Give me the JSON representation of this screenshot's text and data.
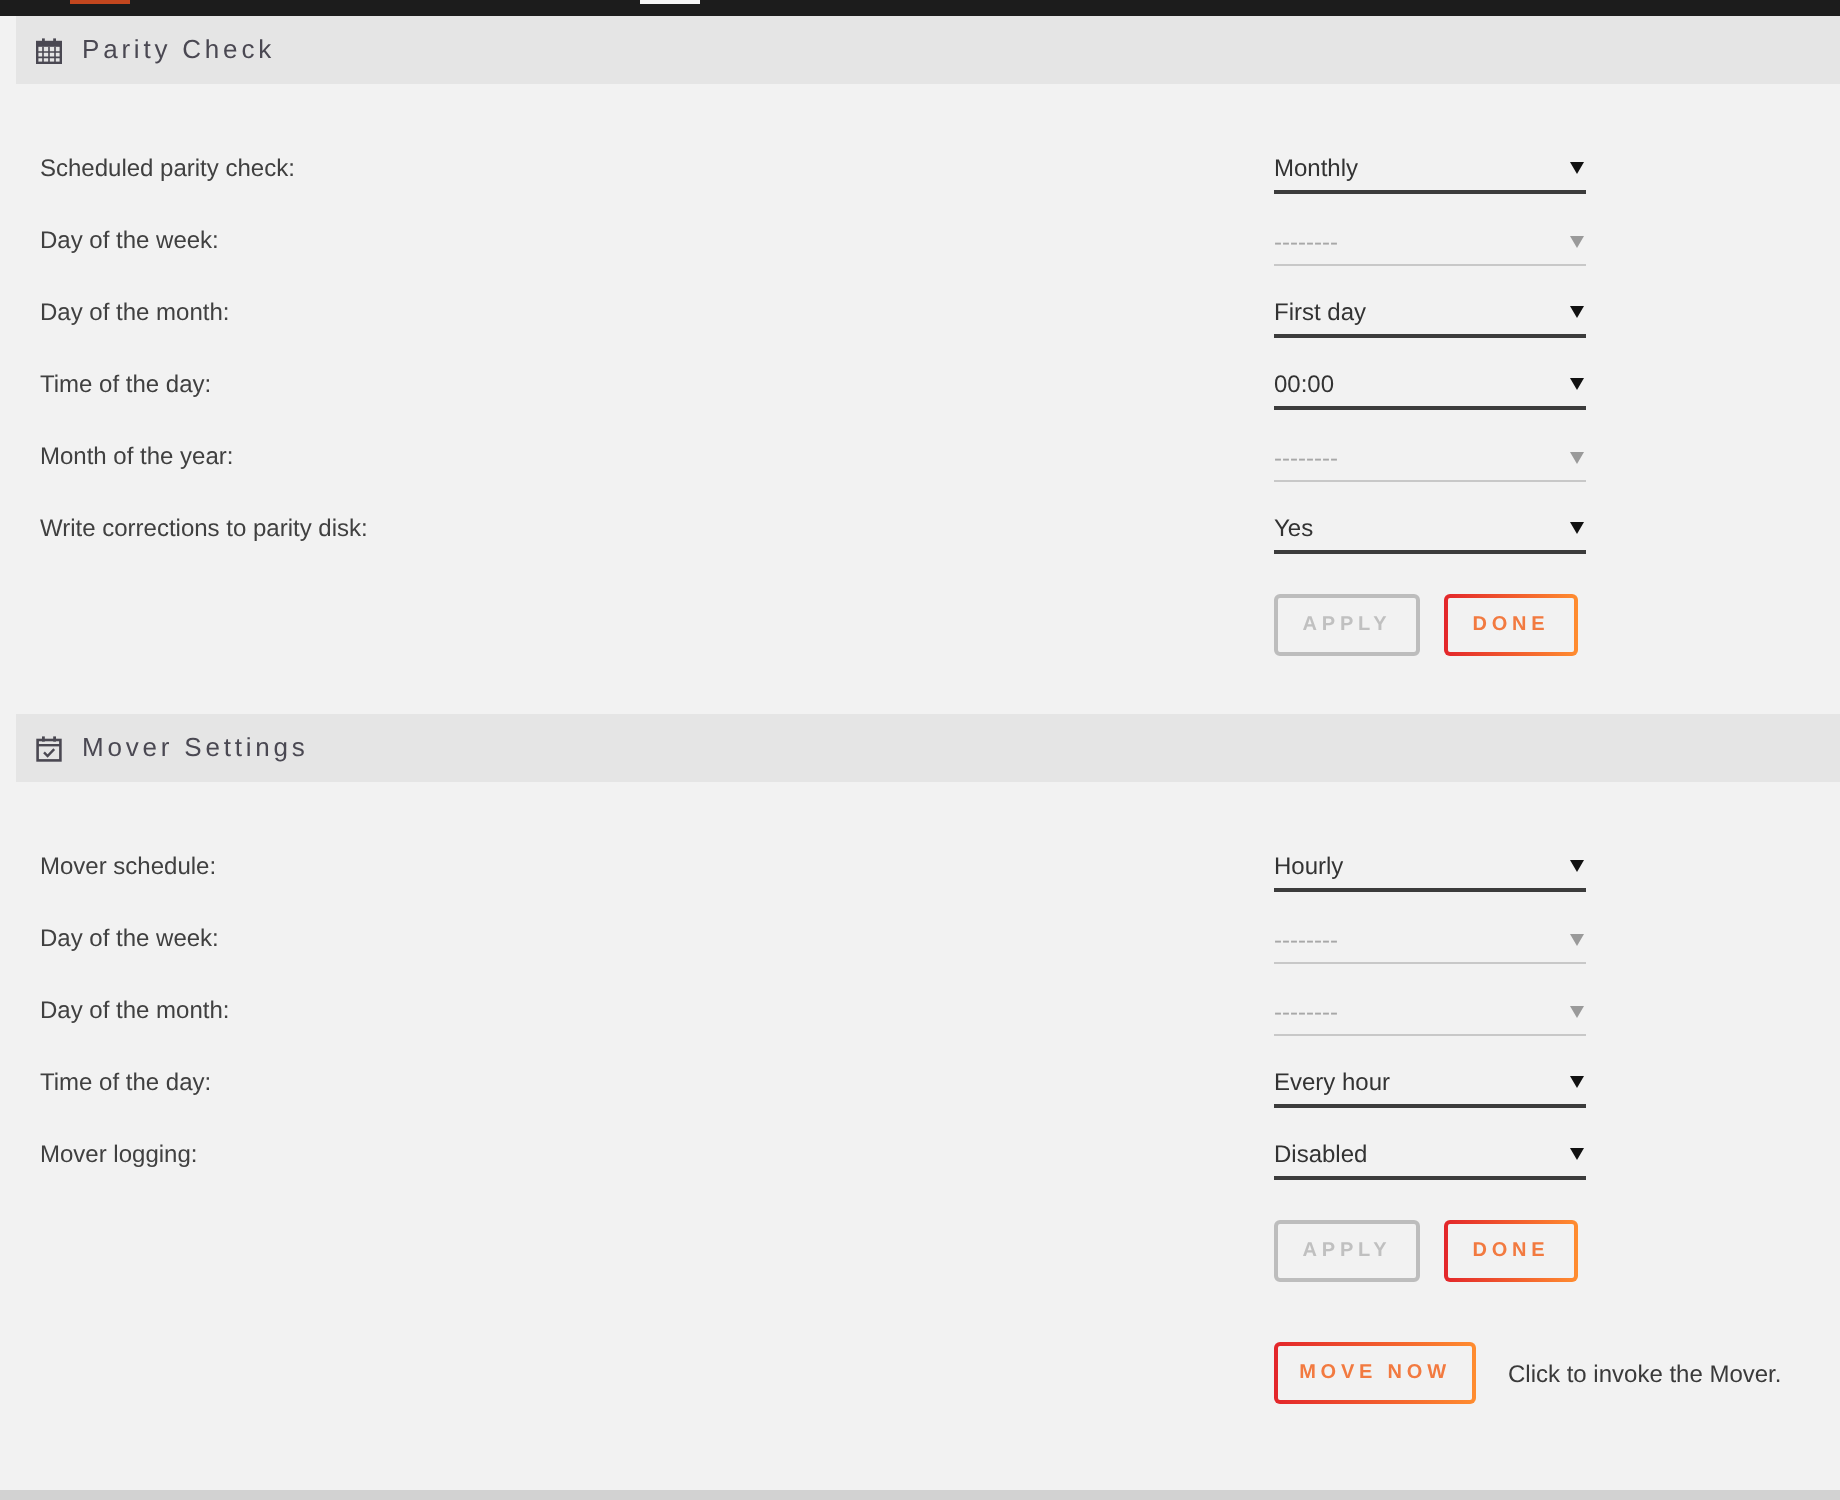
{
  "sections": [
    {
      "title": "Parity Check",
      "fields": [
        {
          "label": "Scheduled parity check:",
          "value": "Monthly",
          "disabled": false
        },
        {
          "label": "Day of the week:",
          "value": "--------",
          "disabled": true
        },
        {
          "label": "Day of the month:",
          "value": "First day",
          "disabled": false
        },
        {
          "label": "Time of the day:",
          "value": "00:00",
          "disabled": false
        },
        {
          "label": "Month of the year:",
          "value": "--------",
          "disabled": true
        },
        {
          "label": "Write corrections to parity disk:",
          "value": "Yes",
          "disabled": false
        }
      ],
      "buttons": [
        {
          "label": "APPLY",
          "disabled": true
        },
        {
          "label": "DONE",
          "disabled": false
        }
      ]
    },
    {
      "title": "Mover Settings",
      "fields": [
        {
          "label": "Mover schedule:",
          "value": "Hourly",
          "disabled": false
        },
        {
          "label": "Day of the week:",
          "value": "--------",
          "disabled": true
        },
        {
          "label": "Day of the month:",
          "value": "--------",
          "disabled": true
        },
        {
          "label": "Time of the day:",
          "value": "Every hour",
          "disabled": false
        },
        {
          "label": "Mover logging:",
          "value": "Disabled",
          "disabled": false
        }
      ],
      "buttons": [
        {
          "label": "APPLY",
          "disabled": true
        },
        {
          "label": "DONE",
          "disabled": false
        }
      ],
      "action": {
        "button": "MOVE NOW",
        "note": "Click to invoke the Mover."
      }
    }
  ]
}
